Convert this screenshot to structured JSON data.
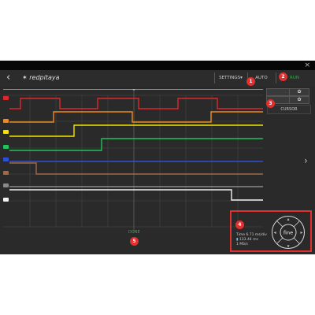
{
  "window": {
    "close_glyph": "×"
  },
  "topbar": {
    "back_glyph": "‹",
    "logo_text": "redpitaya",
    "settings_label": "SETTINGS",
    "settings_chevron": "▾",
    "auto_label": "AUTO",
    "run_label": "RUN"
  },
  "side_panel": {
    "cursor_label": "CURSOR",
    "icon_names": [
      "gear-icon",
      "gear-icon"
    ]
  },
  "status": {
    "done_label": "DONE"
  },
  "time_info": {
    "time_line": "Time 6.71 ms/div",
    "trigger_line": "133.44 ms",
    "rate_line": "1 MS/s"
  },
  "dial": {
    "center_label": "fine",
    "arrows": [
      "▲",
      "▶",
      "▼",
      "◀"
    ]
  },
  "badges": [
    "1",
    "2",
    "3",
    "4",
    "5"
  ],
  "nav": {
    "next_glyph": "›"
  },
  "colors": {
    "background": "#2a2a2a",
    "grid": "#4a4a4a",
    "badge": "#e23030",
    "accent_green": "#3aa84a",
    "channels": [
      "#e0262b",
      "#f08a1c",
      "#f2e400",
      "#22c25c",
      "#2f4fd8",
      "#a06a48",
      "#8a8a8a",
      "#f2f2f2"
    ]
  },
  "channels": [
    {
      "id": "ch1",
      "color": "#e0262b"
    },
    {
      "id": "ch2",
      "color": "#f08a1c"
    },
    {
      "id": "ch3",
      "color": "#f2e400"
    },
    {
      "id": "ch4",
      "color": "#22c25c"
    },
    {
      "id": "ch5",
      "color": "#2f4fd8"
    },
    {
      "id": "ch6",
      "color": "#a06a48"
    },
    {
      "id": "ch7",
      "color": "#8a8a8a"
    },
    {
      "id": "ch8",
      "color": "#f2f2f2"
    }
  ]
}
